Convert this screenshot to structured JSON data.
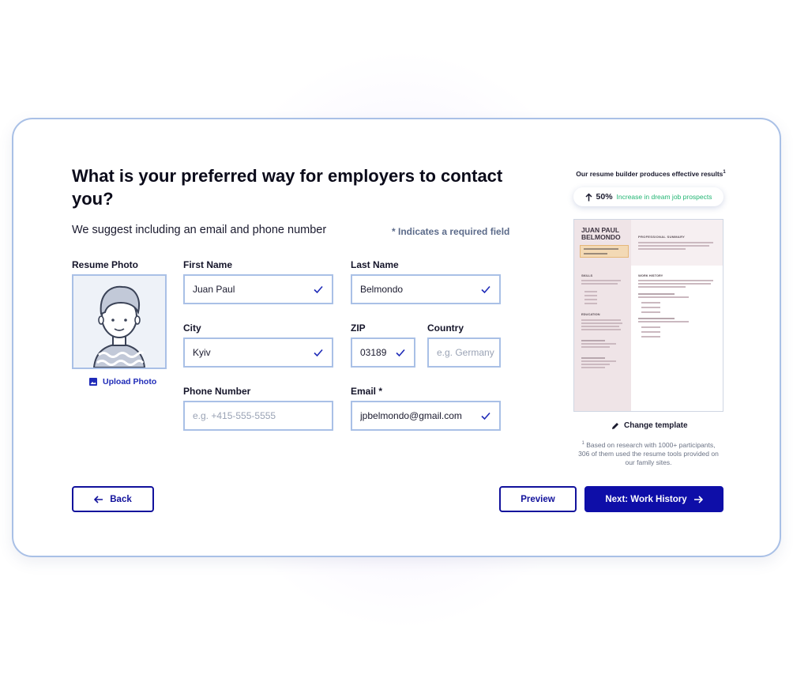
{
  "title": "What is your preferred way for employers to contact you?",
  "subtitle": "We suggest including an email and phone number",
  "required_note": "* Indicates a required field",
  "photo": {
    "label": "Resume Photo",
    "upload_label": "Upload Photo"
  },
  "fields": {
    "first_name": {
      "label": "First Name",
      "value": "Juan Paul"
    },
    "last_name": {
      "label": "Last Name",
      "value": "Belmondo"
    },
    "city": {
      "label": "City",
      "value": "Kyiv"
    },
    "zip": {
      "label": "ZIP",
      "value": "03189"
    },
    "country": {
      "label": "Country",
      "placeholder": "e.g. Germany"
    },
    "phone": {
      "label": "Phone Number",
      "placeholder": "e.g. +415-555-5555"
    },
    "email": {
      "label": "Email *",
      "value": "jpbelmondo@gmail.com"
    }
  },
  "buttons": {
    "back": "Back",
    "preview": "Preview",
    "next": "Next: Work History"
  },
  "right_panel": {
    "title": "Our resume builder produces effective results",
    "title_sup": "1",
    "stat_value": "50%",
    "stat_text": "Increase in dream job prospects",
    "change_template": "Change template",
    "footnote_sup": "1",
    "footnote": "Based on research with 1000+ participants, 306 of them used the resume tools provided on our family sites."
  },
  "resume_preview": {
    "name_line1": "JUAN PAUL",
    "name_line2": "BELMONDO",
    "professional_summary": "PROFESSIONAL SUMMARY",
    "skills": "SKILLS",
    "education": "EDUCATION",
    "work_history": "WORK HISTORY"
  },
  "colors": {
    "accent": "#0e0ea8",
    "border": "#a9c0e6",
    "success": "#22b573",
    "check": "#1f2bb8"
  },
  "icons": [
    "check-icon",
    "arrow-left-icon",
    "arrow-right-icon",
    "arrow-up-icon",
    "image-icon",
    "pencil-icon"
  ]
}
